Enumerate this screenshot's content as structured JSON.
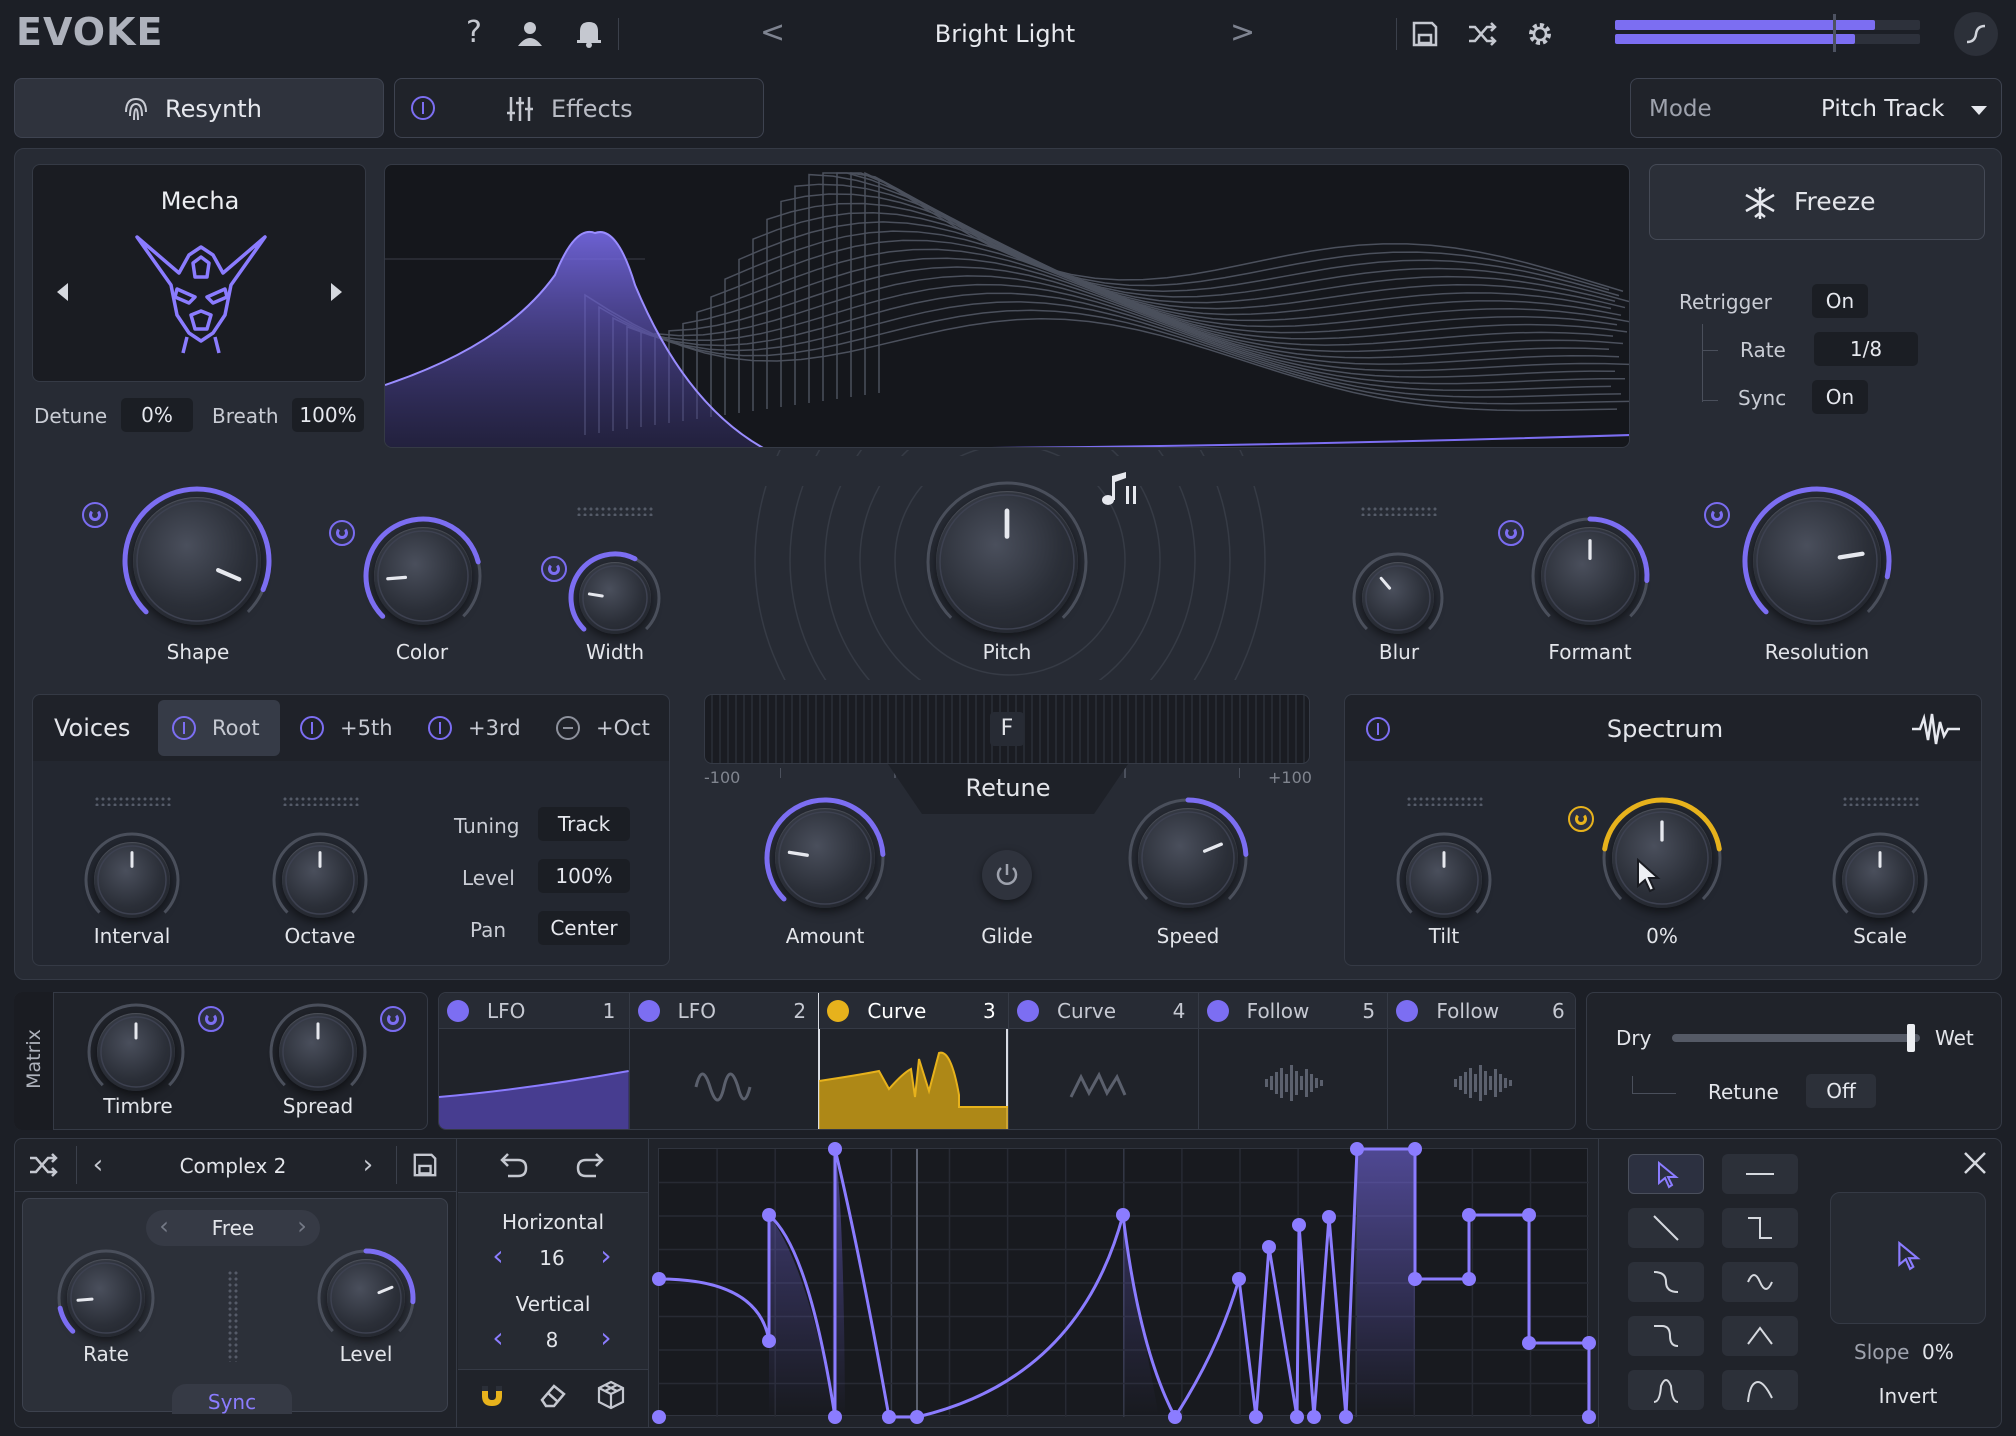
{
  "app": {
    "logo": "EVOKE",
    "preset_name": "Bright Light",
    "prev_glyph": "<",
    "next_glyph": ">"
  },
  "tabs": {
    "resynth": "Resynth",
    "effects": "Effects"
  },
  "mode": {
    "label": "Mode",
    "value": "Pitch Track"
  },
  "voice_model": {
    "name": "Mecha",
    "detune_label": "Detune",
    "detune_value": "0%",
    "breath_label": "Breath",
    "breath_value": "100%"
  },
  "freeze": {
    "label": "Freeze",
    "retrigger_label": "Retrigger",
    "retrigger_value": "On",
    "rate_label": "Rate",
    "rate_value": "1/8",
    "sync_label": "Sync",
    "sync_value": "On"
  },
  "main_knobs": {
    "shape": "Shape",
    "color": "Color",
    "width": "Width",
    "pitch": "Pitch",
    "blur": "Blur",
    "formant": "Formant",
    "resolution": "Resolution"
  },
  "voices": {
    "title": "Voices",
    "root": "Root",
    "fifth": "+5th",
    "third": "+3rd",
    "oct": "+Oct",
    "interval": "Interval",
    "octave": "Octave",
    "tuning_label": "Tuning",
    "tuning_value": "Track",
    "level_label": "Level",
    "level_value": "100%",
    "pan_label": "Pan",
    "pan_value": "Center"
  },
  "retune": {
    "note": "F",
    "min": "-100",
    "max": "+100",
    "title": "Retune",
    "amount": "Amount",
    "glide": "Glide",
    "speed": "Speed"
  },
  "spectrum": {
    "title": "Spectrum",
    "tilt": "Tilt",
    "center_value": "0%",
    "scale": "Scale",
    "center_level": 0.0
  },
  "matrix": {
    "label": "Matrix",
    "timbre": "Timbre",
    "spread": "Spread",
    "slots": [
      {
        "name": "LFO",
        "num": "1"
      },
      {
        "name": "LFO",
        "num": "2"
      },
      {
        "name": "Curve",
        "num": "3"
      },
      {
        "name": "Curve",
        "num": "4"
      },
      {
        "name": "Follow",
        "num": "5"
      },
      {
        "name": "Follow",
        "num": "6"
      }
    ]
  },
  "mix": {
    "dry": "Dry",
    "wet": "Wet",
    "retune_label": "Retune",
    "retune_value": "Off",
    "wet_level": 0.98
  },
  "curve_editor": {
    "preset": "Complex 2",
    "free": "Free",
    "rate": "Rate",
    "level": "Level",
    "sync": "Sync",
    "horizontal_label": "Horizontal",
    "horizontal_value": "16",
    "vertical_label": "Vertical",
    "vertical_value": "8",
    "slope_label": "Slope",
    "slope_value": "0%",
    "invert": "Invert"
  },
  "colors": {
    "accent": "#7c6ef2",
    "yellow": "#e7b21c",
    "panel": "#272b34",
    "bg": "#1c1f26"
  },
  "icons": [
    "help-icon",
    "user-icon",
    "bell-icon",
    "save-icon",
    "shuffle-icon",
    "gear-icon",
    "fingerprint-icon",
    "sliders-icon",
    "snowflake-icon",
    "mecha-head-icon",
    "music-note-icon",
    "waveform-icon",
    "undo-icon",
    "redo-icon",
    "magnet-icon",
    "eraser-icon",
    "cube-icon",
    "close-icon",
    "cursor-icon"
  ]
}
